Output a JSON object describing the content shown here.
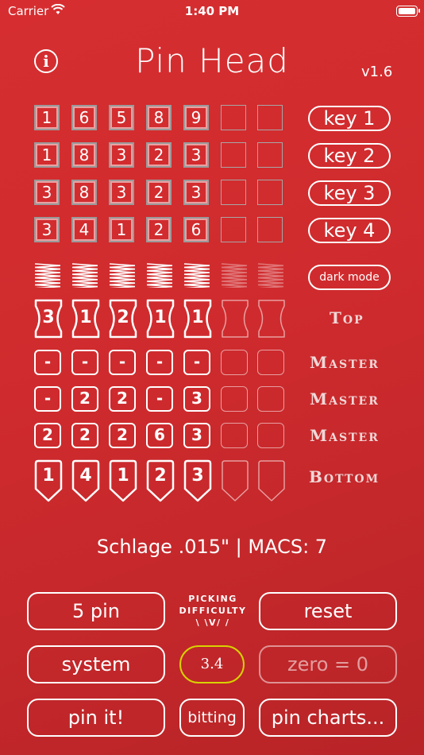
{
  "status_bar": {
    "carrier": "Carrier",
    "time": "1:40 PM"
  },
  "header": {
    "title": "Pin Head",
    "version": "v1.6"
  },
  "keys": [
    {
      "label": "key 1",
      "cuts": [
        "1",
        "6",
        "5",
        "8",
        "9",
        "",
        ""
      ]
    },
    {
      "label": "key 2",
      "cuts": [
        "1",
        "8",
        "3",
        "2",
        "3",
        "",
        ""
      ]
    },
    {
      "label": "key 3",
      "cuts": [
        "3",
        "8",
        "3",
        "2",
        "3",
        "",
        ""
      ]
    },
    {
      "label": "key 4",
      "cuts": [
        "3",
        "4",
        "1",
        "2",
        "6",
        "",
        ""
      ]
    }
  ],
  "dark_mode_label": "dark mode",
  "rows": {
    "top": {
      "label": "Top",
      "values": [
        "3",
        "1",
        "2",
        "1",
        "1",
        "",
        ""
      ]
    },
    "master1": {
      "label": "Master",
      "values": [
        "-",
        "-",
        "-",
        "-",
        "-",
        "",
        ""
      ]
    },
    "master2": {
      "label": "Master",
      "values": [
        "-",
        "2",
        "2",
        "-",
        "3",
        "",
        ""
      ]
    },
    "master3": {
      "label": "Master",
      "values": [
        "2",
        "2",
        "2",
        "6",
        "3",
        "",
        ""
      ]
    },
    "bottom": {
      "label": "Bottom",
      "values": [
        "1",
        "4",
        "1",
        "2",
        "3",
        "",
        ""
      ]
    }
  },
  "info_line": "Schlage .015\" | MACS: 7",
  "controls": {
    "pins_button": "5 pin",
    "reset_button": "reset",
    "difficulty_label_1": "PICKING",
    "difficulty_label_2": "DIFFICULTY",
    "difficulty_marks": "\\ \\V/ /",
    "difficulty_value": "3.4",
    "system_button": "system",
    "zero_button": "zero = 0",
    "pin_it_button": "pin it!",
    "bitting_button": "bitting",
    "pin_charts_button": "pin charts..."
  }
}
